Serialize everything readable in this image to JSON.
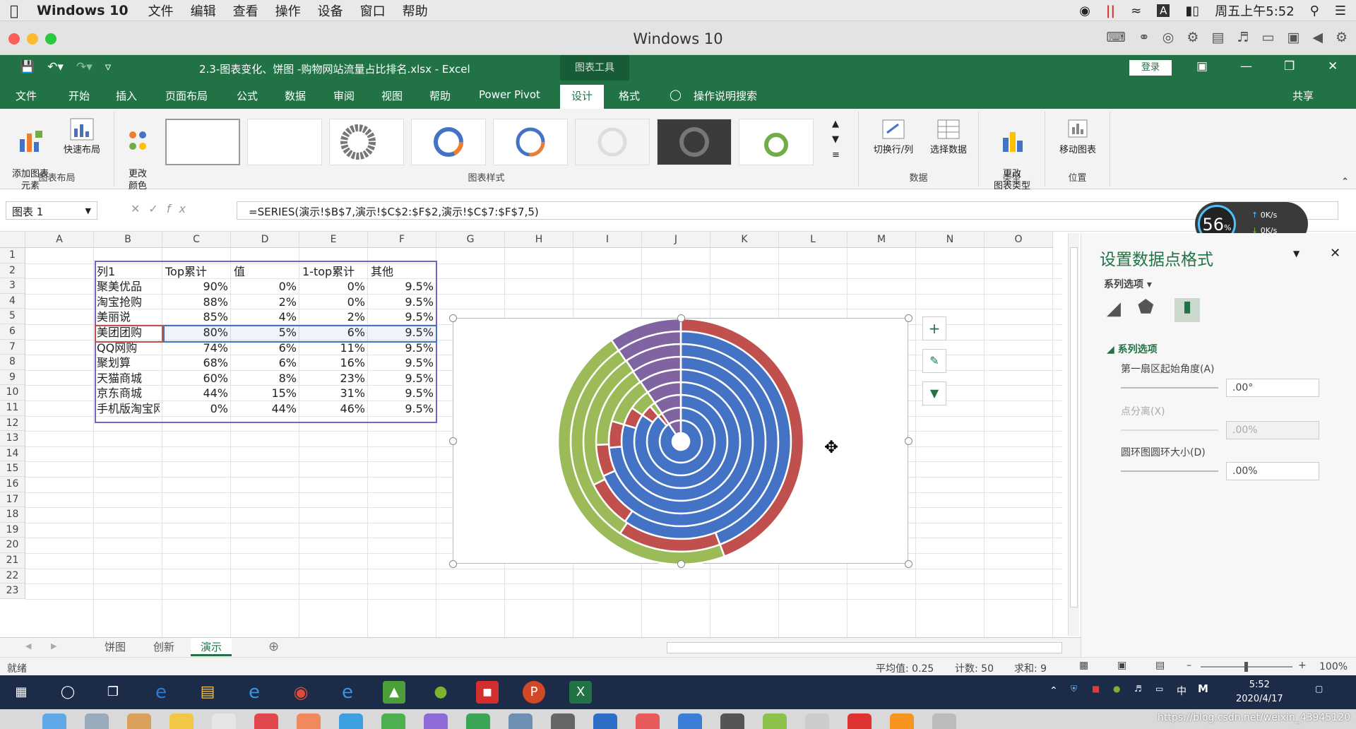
{
  "mac_menu": {
    "app": "Windows 10",
    "items": [
      "文件",
      "编辑",
      "查看",
      "操作",
      "设备",
      "窗口",
      "帮助"
    ],
    "clock": "周五上午5:52"
  },
  "vm_window": {
    "title": "Windows 10"
  },
  "excel": {
    "file_title": "2.3-图表变化、饼图 -购物网站流量占比排名.xlsx  -  Excel",
    "chart_tools": "图表工具",
    "login": "登录",
    "tabs": [
      "文件",
      "开始",
      "插入",
      "页面布局",
      "公式",
      "数据",
      "审阅",
      "视图",
      "帮助",
      "Power Pivot",
      "设计",
      "格式"
    ],
    "active_tab": "设计",
    "tell_me": "操作说明搜索",
    "share": "共享"
  },
  "ribbon": {
    "add_element": "添加图表\n元素",
    "quick_layout": "快速布局",
    "change_color": "更改\n颜色",
    "group_layout": "图表布局",
    "group_styles": "图表样式",
    "switch_rowcol": "切换行/列",
    "select_data": "选择数据",
    "group_data": "数据",
    "change_type": "更改\n图表类型",
    "group_type": "类型",
    "move_chart": "移动图表",
    "group_location": "位置"
  },
  "formula_bar": {
    "name_box": "图表 1",
    "fx": "fx",
    "formula": "=SERIES(演示!$B$7,演示!$C$2:$F$2,演示!$C$7:$F$7,5)"
  },
  "columns": [
    "A",
    "B",
    "C",
    "D",
    "E",
    "F",
    "G",
    "H",
    "I",
    "J",
    "K",
    "L",
    "M",
    "N",
    "O"
  ],
  "rows": [
    "1",
    "2",
    "3",
    "4",
    "5",
    "6",
    "7",
    "8",
    "9",
    "10",
    "11",
    "12",
    "13",
    "14",
    "15",
    "16",
    "17",
    "18",
    "19",
    "20",
    "21",
    "22",
    "23"
  ],
  "table": {
    "headers": [
      "列1",
      "Top累计",
      "值",
      "1-top累计",
      "其他"
    ],
    "rows": [
      [
        "聚美优品",
        "90%",
        "0%",
        "0%",
        "9.5%"
      ],
      [
        "淘宝抢购",
        "88%",
        "2%",
        "0%",
        "9.5%"
      ],
      [
        "美丽说",
        "85%",
        "4%",
        "2%",
        "9.5%"
      ],
      [
        "美团团购",
        "80%",
        "5%",
        "6%",
        "9.5%"
      ],
      [
        "QQ网购",
        "74%",
        "6%",
        "11%",
        "9.5%"
      ],
      [
        "聚划算",
        "68%",
        "6%",
        "16%",
        "9.5%"
      ],
      [
        "天猫商城",
        "60%",
        "8%",
        "23%",
        "9.5%"
      ],
      [
        "京东商城",
        "44%",
        "15%",
        "31%",
        "9.5%"
      ],
      [
        "手机版淘宝网",
        "0%",
        "44%",
        "46%",
        "9.5%"
      ]
    ]
  },
  "chart_data": {
    "type": "doughnut",
    "categories": [
      "Top累计",
      "值",
      "1-top累计",
      "其他"
    ],
    "series": [
      {
        "name": "聚美优品",
        "values": [
          90,
          0,
          0,
          9.5
        ]
      },
      {
        "name": "淘宝抢购",
        "values": [
          88,
          2,
          0,
          9.5
        ]
      },
      {
        "name": "美丽说",
        "values": [
          85,
          4,
          2,
          9.5
        ]
      },
      {
        "name": "美团团购",
        "values": [
          80,
          5,
          6,
          9.5
        ]
      },
      {
        "name": "QQ网购",
        "values": [
          74,
          6,
          11,
          9.5
        ]
      },
      {
        "name": "聚划算",
        "values": [
          68,
          6,
          16,
          9.5
        ]
      },
      {
        "name": "天猫商城",
        "values": [
          60,
          8,
          23,
          9.5
        ]
      },
      {
        "name": "京东商城",
        "values": [
          44,
          15,
          31,
          9.5
        ]
      },
      {
        "name": "手机版淘宝网",
        "values": [
          0,
          44,
          46,
          9.5
        ]
      }
    ],
    "colors": [
      "#4472c4",
      "#c0504d",
      "#9bbb59",
      "#8064a2"
    ]
  },
  "sheet_tabs": [
    "饼图",
    "创新",
    "演示"
  ],
  "active_sheet": "演示",
  "status": {
    "ready": "就绪",
    "avg": "平均值: 0.25",
    "count": "计数: 50",
    "sum": "求和: 9",
    "zoom": "100%"
  },
  "format_panel": {
    "title": "设置数据点格式",
    "series_options": "系列选项",
    "section": "系列选项",
    "angle_label": "第一扇区起始角度(A)",
    "angle_value": ".00°",
    "explosion_label": "点分离(X)",
    "explosion_value": ".00%",
    "hole_label": "圆环图圆环大小(D)",
    "hole_value": ".00%"
  },
  "speed_widget": {
    "percent": "56",
    "unit": "%",
    "up": "0K/s",
    "down": "0K/s"
  },
  "taskbar": {
    "time": "5:52",
    "date": "2020/4/17",
    "ime": "中"
  },
  "watermark": "https://blog.csdn.net/weixin_43945120"
}
